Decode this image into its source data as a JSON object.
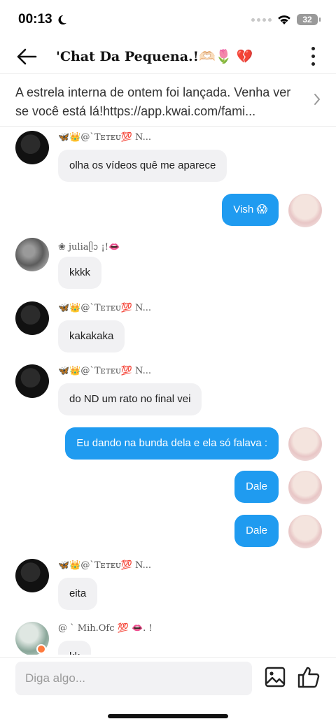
{
  "status_bar": {
    "time": "00:13",
    "battery": "32"
  },
  "header": {
    "title": "'Chat Da Pequena.!🫶🏻🌷 💔"
  },
  "announcement": {
    "text": "A estrela interna de ontem foi lançada. Venha ver se você está lá!https://app.kwai.com/fami..."
  },
  "messages": [
    {
      "sender": "🦋👑@`Tᴇᴛᴇᴜ💯 N...",
      "text": "olha os vídeos quê me aparece"
    },
    {
      "text": "Vish 😱"
    },
    {
      "sender": "❀ juliaᥫᩣ ¡!👄",
      "text": "kkkk"
    },
    {
      "sender": "🦋👑@`Tᴇᴛᴇᴜ💯 N...",
      "text": "kakakaka"
    },
    {
      "sender": "🦋👑@`Tᴇᴛᴇᴜ💯 N...",
      "text": "do ND um rato no final vei"
    },
    {
      "text": "Eu dando na bunda dela e ela só falava :"
    },
    {
      "text": "Dale"
    },
    {
      "text": "Dale"
    },
    {
      "sender": "🦋👑@`Tᴇᴛᴇᴜ💯 N...",
      "text": "eita"
    },
    {
      "sender": "@ ` Mih.Ofc 💯 👄. !",
      "text": "kk"
    }
  ],
  "input": {
    "placeholder": "Diga algo..."
  },
  "icons": {
    "back": "back-arrow-icon",
    "menu": "more-vertical-icon",
    "chevron": "chevron-right-icon",
    "image": "image-icon",
    "like": "thumbs-up-icon"
  },
  "colors": {
    "outgoing_bubble": "#1f9bf0",
    "incoming_bubble": "#f1f1f3"
  }
}
